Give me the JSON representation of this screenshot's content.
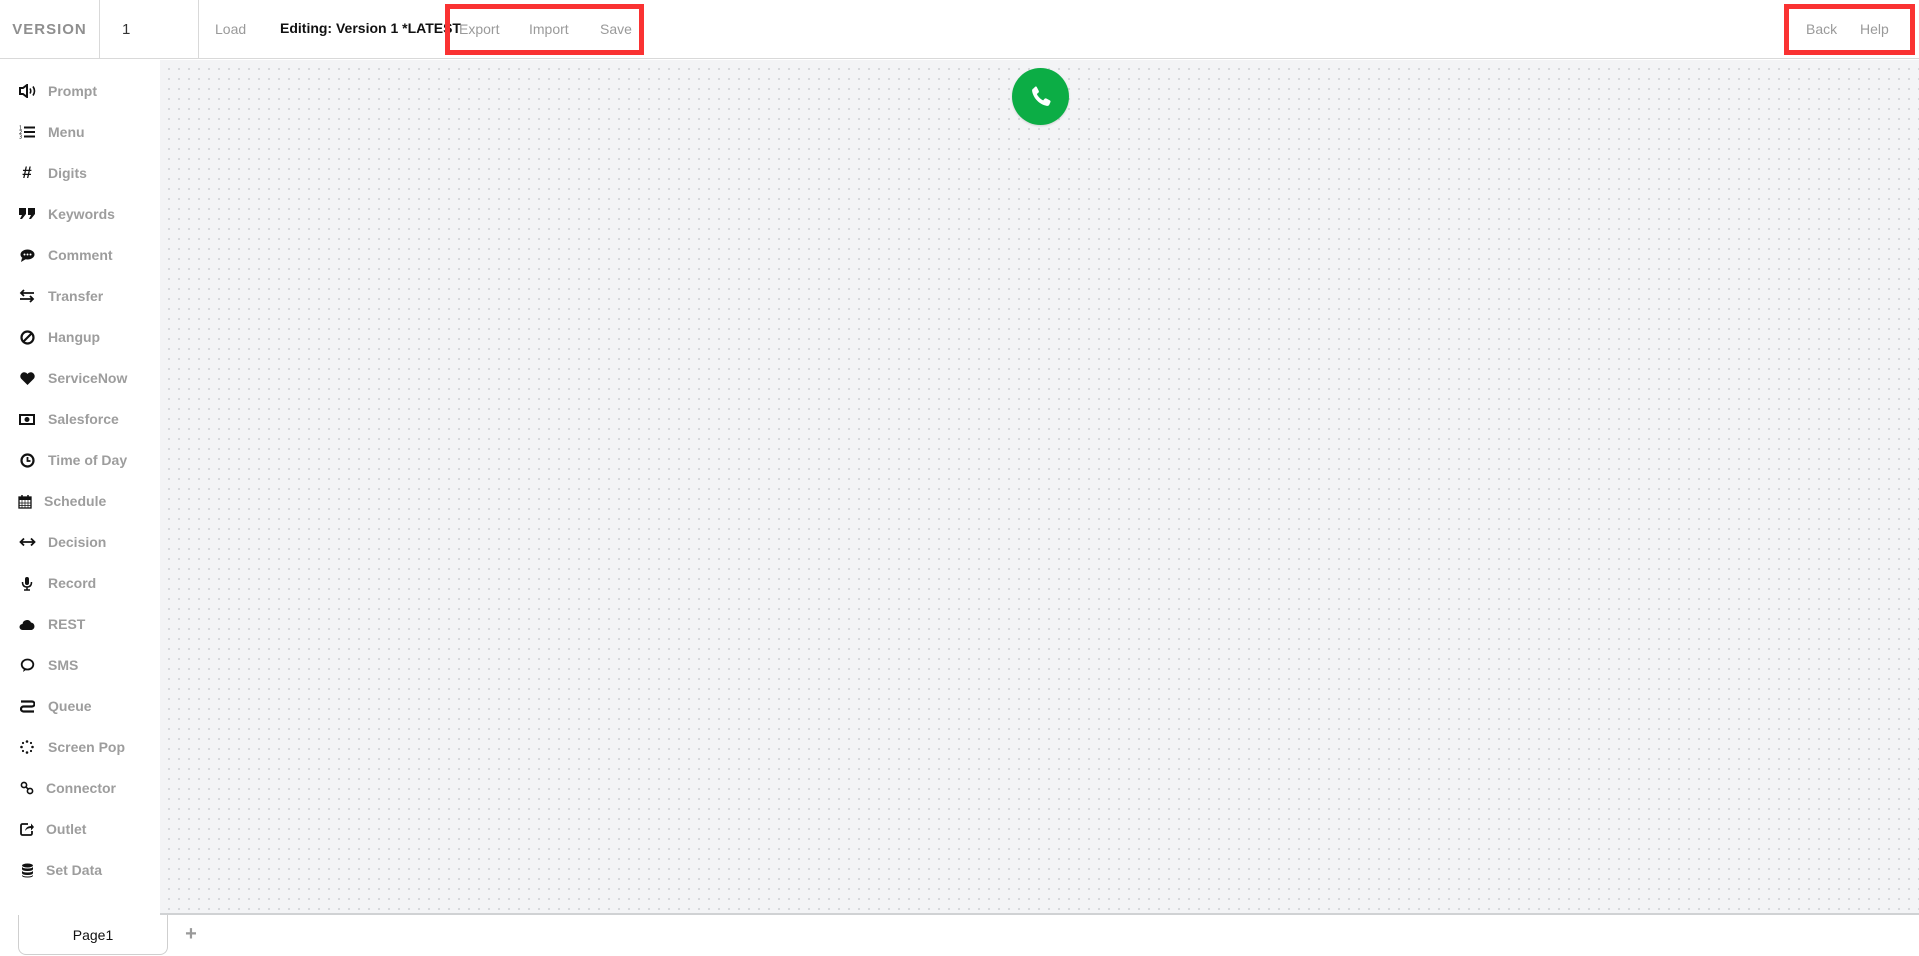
{
  "header": {
    "version_label": "VERSION",
    "version_value": "1",
    "load_label": "Load",
    "editing_label": "Editing: Version 1 *LATEST",
    "export_label": "Export",
    "import_label": "Import",
    "save_label": "Save",
    "back_label": "Back",
    "help_label": "Help"
  },
  "sidebar": {
    "items": [
      {
        "label": "Prompt",
        "icon": "volume-icon"
      },
      {
        "label": "Menu",
        "icon": "numbered-list-icon"
      },
      {
        "label": "Digits",
        "icon": "hashtag-icon"
      },
      {
        "label": "Keywords",
        "icon": "quote-icon"
      },
      {
        "label": "Comment",
        "icon": "comment-icon"
      },
      {
        "label": "Transfer",
        "icon": "exchange-icon"
      },
      {
        "label": "Hangup",
        "icon": "ban-icon"
      },
      {
        "label": "ServiceNow",
        "icon": "heart-icon"
      },
      {
        "label": "Salesforce",
        "icon": "money-icon"
      },
      {
        "label": "Time of Day",
        "icon": "clock-icon"
      },
      {
        "label": "Schedule",
        "icon": "calendar-icon"
      },
      {
        "label": "Decision",
        "icon": "arrows-h-icon"
      },
      {
        "label": "Record",
        "icon": "microphone-icon"
      },
      {
        "label": "REST",
        "icon": "cloud-icon"
      },
      {
        "label": "SMS",
        "icon": "chat-bubble-icon"
      },
      {
        "label": "Queue",
        "icon": "queue-icon"
      },
      {
        "label": "Screen Pop",
        "icon": "spinner-icon"
      },
      {
        "label": "Connector",
        "icon": "link-icon"
      },
      {
        "label": "Outlet",
        "icon": "share-square-icon"
      },
      {
        "label": "Set Data",
        "icon": "database-icon"
      }
    ]
  },
  "canvas": {
    "start_node_icon": "phone-icon",
    "start_node_color": "#0cad45"
  },
  "pages": {
    "tabs": [
      {
        "label": "Page1"
      }
    ],
    "add_label": "+"
  },
  "highlight_color": "#fa3232"
}
